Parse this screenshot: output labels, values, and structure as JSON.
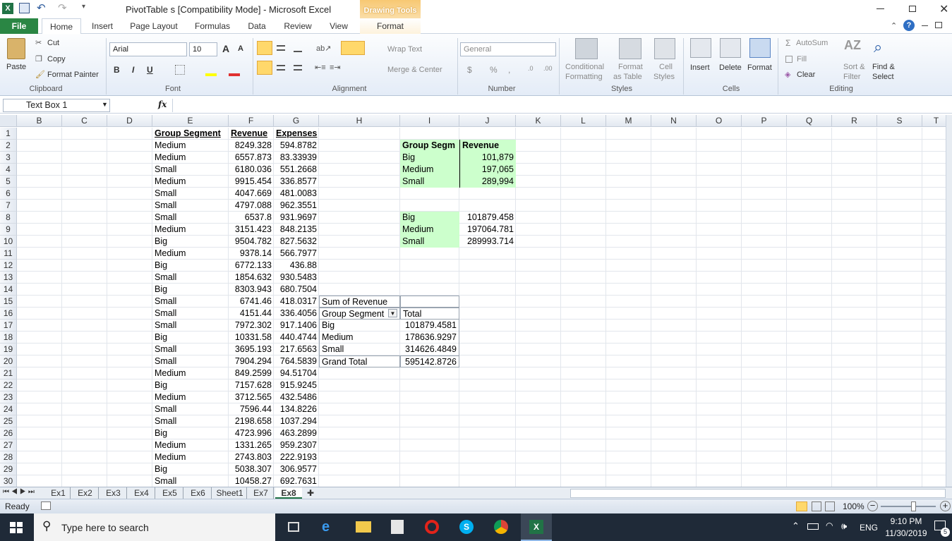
{
  "title": {
    "text": "PivotTable s  [Compatibility Mode]  -  Microsoft Excel",
    "context_tab_group": "Drawing Tools"
  },
  "tabs": [
    "File",
    "Home",
    "Insert",
    "Page Layout",
    "Formulas",
    "Data",
    "Review",
    "View",
    "Format"
  ],
  "ribbon": {
    "clipboard": {
      "paste": "Paste",
      "cut": "Cut",
      "copy": "Copy",
      "format_painter": "Format Painter",
      "label": "Clipboard"
    },
    "font": {
      "name": "Arial",
      "size": "10",
      "bold": "B",
      "italic": "I",
      "underline": "U",
      "grow": "A",
      "shrink": "A",
      "label": "Font"
    },
    "alignment": {
      "wrap": "Wrap Text",
      "merge": "Merge & Center",
      "label": "Alignment"
    },
    "number": {
      "format": "General",
      "currency": "$",
      "percent": "%",
      "comma": ",",
      "inc": ".0",
      "dec": ".00",
      "label": "Number"
    },
    "styles": {
      "conditional": "Conditional",
      "conditional2": "Formatting",
      "format_table": "Format",
      "format_table2": "as Table",
      "cell_styles": "Cell",
      "cell_styles2": "Styles",
      "label": "Styles"
    },
    "cells": {
      "insert": "Insert",
      "delete": "Delete",
      "format": "Format",
      "label": "Cells"
    },
    "editing": {
      "autosum": "AutoSum",
      "fill": "Fill",
      "clear": "Clear",
      "sort": "Sort &",
      "sort2": "Filter",
      "find": "Find &",
      "find2": "Select",
      "label": "Editing"
    }
  },
  "formula_bar": {
    "name_box": "Text Box 1",
    "fx": "fx",
    "formula": ""
  },
  "columns": [
    "B",
    "C",
    "D",
    "E",
    "F",
    "G",
    "H",
    "I",
    "J",
    "K",
    "L",
    "M",
    "N",
    "O",
    "P",
    "Q",
    "R",
    "S",
    "T"
  ],
  "rows": [
    "1",
    "2",
    "3",
    "4",
    "5",
    "6",
    "7",
    "8",
    "9",
    "10",
    "11",
    "12",
    "13",
    "14",
    "15",
    "16",
    "17",
    "18",
    "19",
    "20",
    "21",
    "22",
    "23",
    "24",
    "25",
    "26",
    "27",
    "28",
    "29",
    "30"
  ],
  "data_headers": {
    "e": "Group Segment",
    "f": "Revenue",
    "g": "Expenses"
  },
  "data_rows": [
    [
      "Medium",
      "8249.328",
      "594.8782"
    ],
    [
      "Medium",
      "6557.873",
      "83.33939"
    ],
    [
      "Small",
      "6180.036",
      "551.2668"
    ],
    [
      "Medium",
      "9915.454",
      "336.8577"
    ],
    [
      "Small",
      "4047.669",
      "481.0083"
    ],
    [
      "Small",
      "4797.088",
      "962.3551"
    ],
    [
      "Small",
      "6537.8",
      "931.9697"
    ],
    [
      "Medium",
      "3151.423",
      "848.2135"
    ],
    [
      "Big",
      "9504.782",
      "827.5632"
    ],
    [
      "Medium",
      "9378.14",
      "566.7977"
    ],
    [
      "Big",
      "6772.133",
      "436.88"
    ],
    [
      "Small",
      "1854.632",
      "930.5483"
    ],
    [
      "Big",
      "8303.943",
      "680.7504"
    ],
    [
      "Small",
      "6741.46",
      "418.0317"
    ],
    [
      "Small",
      "4151.44",
      "336.4056"
    ],
    [
      "Small",
      "7972.302",
      "917.1406"
    ],
    [
      "Big",
      "10331.58",
      "440.4744"
    ],
    [
      "Small",
      "3695.193",
      "217.6563"
    ],
    [
      "Small",
      "7904.294",
      "764.5839"
    ],
    [
      "Medium",
      "849.2599",
      "94.51704"
    ],
    [
      "Big",
      "7157.628",
      "915.9245"
    ],
    [
      "Medium",
      "3712.565",
      "432.5486"
    ],
    [
      "Small",
      "7596.44",
      "134.8226"
    ],
    [
      "Small",
      "2198.658",
      "1037.294"
    ],
    [
      "Big",
      "4723.996",
      "463.2899"
    ],
    [
      "Medium",
      "1331.265",
      "959.2307"
    ],
    [
      "Medium",
      "2743.803",
      "222.9193"
    ],
    [
      "Big",
      "5038.307",
      "306.9577"
    ],
    [
      "Small",
      "10458.27",
      "692.7631"
    ]
  ],
  "summary1": {
    "header_seg": "Group Segm",
    "header_rev": "Revenue",
    "rows": [
      [
        "Big",
        "101,879"
      ],
      [
        "Medium",
        "197,065"
      ],
      [
        "Small",
        "289,994"
      ]
    ]
  },
  "summary2": {
    "rows": [
      [
        "Big",
        "101879.458"
      ],
      [
        "Medium",
        "197064.781"
      ],
      [
        "Small",
        "289993.714"
      ]
    ]
  },
  "pivot": {
    "title": "Sum of Revenue",
    "row_label": "Group Segment",
    "total_label": "Total",
    "rows": [
      [
        "Big",
        "101879.4581"
      ],
      [
        "Medium",
        "178636.9297"
      ],
      [
        "Small",
        "314626.4849"
      ]
    ],
    "grand_total_label": "Grand Total",
    "grand_total": "595142.8726"
  },
  "sheet_tabs": [
    "Ex1",
    "Ex2",
    "Ex3",
    "Ex4",
    "Ex5",
    "Ex6",
    "Sheet1",
    "Ex7",
    "Ex8"
  ],
  "active_sheet": "Ex8",
  "status": {
    "ready": "Ready",
    "zoom": "100%"
  },
  "taskbar": {
    "search_placeholder": "Type here to search",
    "lang": "ENG",
    "time": "9:10 PM",
    "date": "11/30/2019",
    "notif": "5"
  },
  "colors": {
    "excel_green": "#217346",
    "summary_fill": "#ccffcc",
    "file_tab": "#2a8644",
    "context_tab": "#f6c26b"
  }
}
